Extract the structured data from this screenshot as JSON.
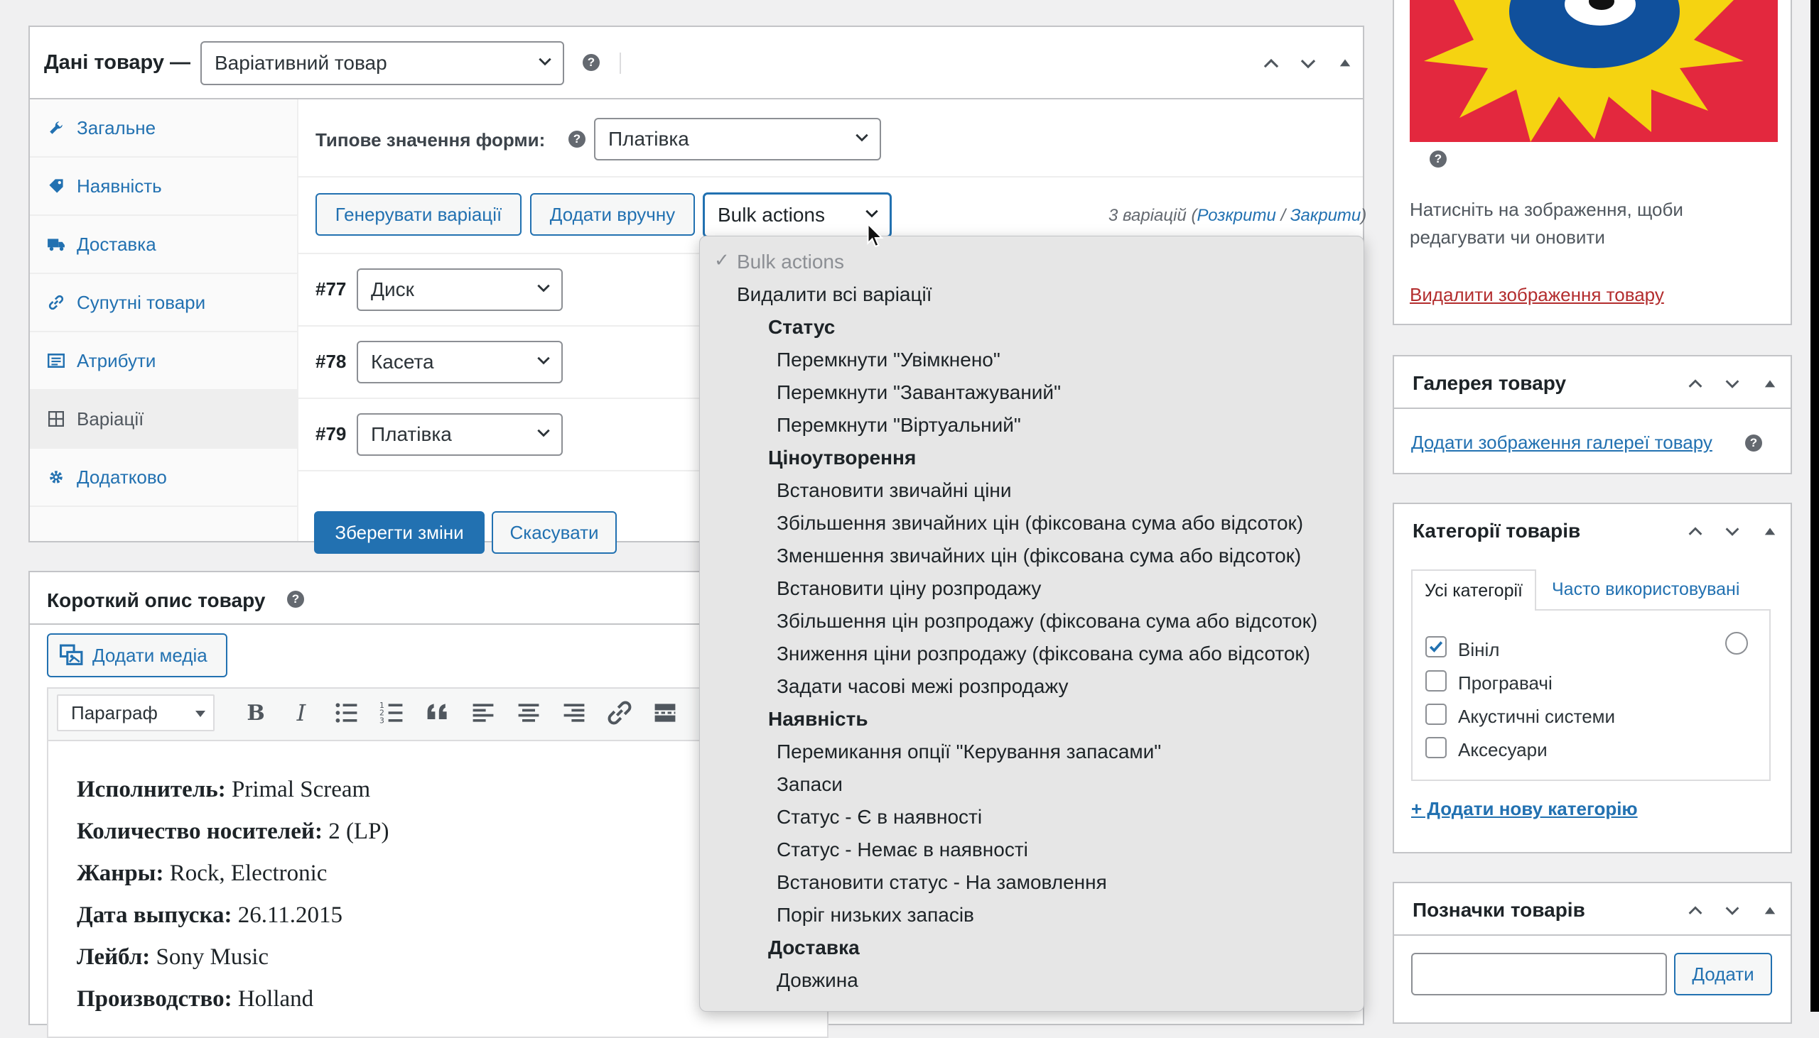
{
  "product_data": {
    "title": "Дані товару —",
    "product_type": "Варіативний товар",
    "tabs": [
      {
        "label": "Загальне",
        "icon": "wrench-icon"
      },
      {
        "label": "Наявність",
        "icon": "tag-icon"
      },
      {
        "label": "Доставка",
        "icon": "truck-icon"
      },
      {
        "label": "Супутні товари",
        "icon": "link-icon"
      },
      {
        "label": "Атрибути",
        "icon": "list-icon"
      },
      {
        "label": "Варіації",
        "icon": "grid-icon"
      },
      {
        "label": "Додатково",
        "icon": "gear-icon"
      }
    ],
    "default_form_label": "Типове значення форми:",
    "default_form_value": "Платівка",
    "generate_label": "Генерувати варіації",
    "add_manual_label": "Додати вручну",
    "bulk_actions_label": "Bulk actions",
    "variations_count": "3 варіацій",
    "expand_label": "Розкрити",
    "collapse_label": "Закрити",
    "variations": [
      {
        "id": "#77",
        "value": "Диск"
      },
      {
        "id": "#78",
        "value": "Касета"
      },
      {
        "id": "#79",
        "value": "Платівка"
      }
    ],
    "save_label": "Зберегти зміни",
    "cancel_label": "Скасувати"
  },
  "bulk_menu": {
    "selected": "Bulk actions",
    "delete_all": "Видалити всі варіації",
    "groups": [
      {
        "name": "Статус",
        "items": [
          "Перемкнути \"Увімкнено\"",
          "Перемкнути \"Завантажуваний\"",
          "Перемкнути \"Віртуальний\""
        ]
      },
      {
        "name": "Ціноутворення",
        "items": [
          "Встановити звичайні ціни",
          "Збільшення звичайних цін (фіксована сума або відсоток)",
          "Зменшення звичайних цін (фіксована сума або відсоток)",
          "Встановити ціну розпродажу",
          "Збільшення цін розпродажу (фіксована сума або відсоток)",
          "Зниження ціни розпродажу (фіксована сума або відсоток)",
          "Задати часові межі розпродажу"
        ]
      },
      {
        "name": "Наявність",
        "items": [
          "Перемикання опції \"Керування запасами\"",
          "Запаси",
          "Статус - Є в наявності",
          "Статус - Немає в наявності",
          "Встановити статус - На замовлення",
          "Поріг низьких запасів"
        ]
      },
      {
        "name": "Доставка",
        "items": [
          "Довжина"
        ]
      }
    ]
  },
  "short_description": {
    "title": "Короткий опис товару",
    "add_media": "Додати медіа",
    "format": "Параграф",
    "lines": [
      {
        "label": "Исполнитель:",
        "value": " Primal Scream"
      },
      {
        "label": "Количество носителей:",
        "value": " 2 (LP)"
      },
      {
        "label": "Жанры:",
        "value": " Rock, Electronic"
      },
      {
        "label": "Дата выпуска:",
        "value": " 26.11.2015"
      },
      {
        "label": "Лейбл:",
        "value": " Sony Music"
      },
      {
        "label": "Производство:",
        "value": " Holland"
      }
    ]
  },
  "sidebar": {
    "image_hint": "Натисніть на зображення, щоби редагувати чи оновити",
    "remove_image": "Видалити зображення товару",
    "gallery": {
      "title": "Галерея товару",
      "add_link": "Додати зображення галереї товару"
    },
    "categories": {
      "title": "Категорії товарів",
      "tab_all": "Усі категорії",
      "tab_popular": "Часто використовувані",
      "items": [
        {
          "label": "Вініл",
          "checked": true
        },
        {
          "label": "Програвачі",
          "checked": false
        },
        {
          "label": "Акустичні системи",
          "checked": false
        },
        {
          "label": "Аксесуари",
          "checked": false
        }
      ],
      "add_new": "+ Додати нову категорію"
    },
    "tags": {
      "title": "Позначки товарів",
      "add_button": "Додати",
      "input_value": ""
    }
  },
  "colors": {
    "accent": "#2271b1",
    "link_red": "#b32d2e",
    "image_red": "#e3283e",
    "image_yellow": "#f5d311",
    "image_blue": "#10509c"
  }
}
